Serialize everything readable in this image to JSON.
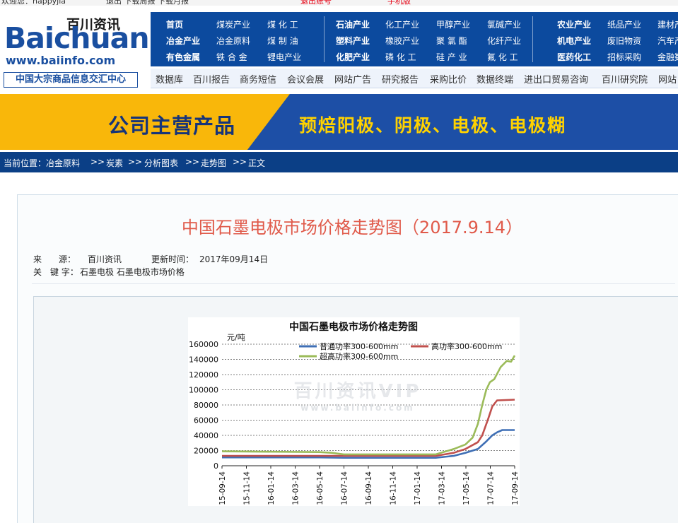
{
  "top_strip": [
    "欢迎您：happyjia",
    "退出  下载周报  下载月报",
    "退出账号",
    "手机版"
  ],
  "logo": {
    "wordmark_main": "Baichuan",
    "wordmark_cn": "百川资讯",
    "url": "www.baiinfo.com",
    "slogan": "中国大宗商品信息交汇中心"
  },
  "nav_grid": [
    [
      "首页",
      "煤炭产业",
      "煤 化 工",
      "石油产业",
      "化工产业",
      "甲醇产业",
      "氯碱产业",
      "农业产业",
      "纸品产业",
      "建材产"
    ],
    [
      "冶金产业",
      "冶金原料",
      "煤 制 油",
      "塑料产业",
      "橡胶产业",
      "聚 氯 酯",
      "化纤产业",
      "机电产业",
      "废旧物资",
      "汽车产"
    ],
    [
      "有色金属",
      "铁 合 金",
      "锂电产业",
      "化肥产业",
      "磷 化 工",
      "硅 产 业",
      "氟 化 工",
      "医药化工",
      "招标采购",
      "金融数"
    ]
  ],
  "sub_nav": [
    "数据库",
    "百川报告",
    "商务短信",
    "会议会展",
    "网站广告",
    "研究报告",
    "采购比价",
    "数据终端",
    "进出口贸易咨询",
    "百川研究院",
    "网站"
  ],
  "banner": {
    "title": "公司主营产品",
    "products": "预焙阳极、阴极、电极、电极糊",
    "colors": {
      "left": "#f9b70a",
      "right": "#1d4fa6"
    }
  },
  "breadcrumb": [
    "当前位置：冶金原料",
    ">>",
    "炭素",
    ">>",
    "分析图表",
    ">>",
    "走势图",
    ">>",
    "正文"
  ],
  "article": {
    "title": "中国石墨电极市场价格走势图（2017.9.14）",
    "source_label": "来　　源：",
    "source": "百川资讯",
    "updated_label": "更新时间：",
    "updated": "2017年09月14日",
    "keywords_label": "关　键 字：",
    "keywords": "石墨电极 石墨电极市场价格"
  },
  "chart_data": {
    "type": "line",
    "title": "中国石墨电极市场价格走势图",
    "ylabel": "元/吨",
    "xlabel": "",
    "ylim": [
      0,
      160000
    ],
    "yticks": [
      0,
      20000,
      40000,
      60000,
      80000,
      100000,
      120000,
      140000,
      160000
    ],
    "xticks": [
      "15-09-14",
      "15-11-14",
      "16-01-14",
      "16-03-14",
      "16-05-14",
      "16-07-14",
      "16-09-14",
      "16-11-14",
      "17-01-14",
      "17-03-14",
      "17-05-14",
      "17-07-14",
      "17-09-14"
    ],
    "grid": true,
    "legend_placement": "top",
    "watermark": [
      "百川资讯VIP",
      "www.baiinfo.com"
    ],
    "series": [
      {
        "name": "普通功率300-600mm",
        "color": "#3f6fb5",
        "points": [
          [
            "2015-09-14",
            11000
          ],
          [
            "2016-05-14",
            11000
          ],
          [
            "2016-07-14",
            10500
          ],
          [
            "2017-03-01",
            10500
          ],
          [
            "2017-04-15",
            13000
          ],
          [
            "2017-05-14",
            17000
          ],
          [
            "2017-06-14",
            22000
          ],
          [
            "2017-07-05",
            32000
          ],
          [
            "2017-07-20",
            40000
          ],
          [
            "2017-08-01",
            44000
          ],
          [
            "2017-08-14",
            47000
          ],
          [
            "2017-09-14",
            47000
          ]
        ]
      },
      {
        "name": "高功率300-600mm",
        "color": "#c0504d",
        "points": [
          [
            "2015-09-14",
            13000
          ],
          [
            "2016-05-14",
            13000
          ],
          [
            "2016-07-14",
            13000
          ],
          [
            "2017-03-01",
            13000
          ],
          [
            "2017-04-15",
            17000
          ],
          [
            "2017-05-14",
            22000
          ],
          [
            "2017-06-14",
            31000
          ],
          [
            "2017-06-25",
            40000
          ],
          [
            "2017-07-10",
            62000
          ],
          [
            "2017-07-20",
            78000
          ],
          [
            "2017-08-01",
            86000
          ],
          [
            "2017-09-14",
            87000
          ]
        ]
      },
      {
        "name": "超高功率300-600mm",
        "color": "#9bbb59",
        "points": [
          [
            "2015-09-14",
            19000
          ],
          [
            "2016-05-14",
            18000
          ],
          [
            "2016-06-14",
            17000
          ],
          [
            "2016-07-14",
            15000
          ],
          [
            "2017-03-01",
            15000
          ],
          [
            "2017-04-15",
            22000
          ],
          [
            "2017-05-14",
            28000
          ],
          [
            "2017-06-01",
            37000
          ],
          [
            "2017-06-14",
            55000
          ],
          [
            "2017-06-25",
            80000
          ],
          [
            "2017-07-05",
            100000
          ],
          [
            "2017-07-14",
            110000
          ],
          [
            "2017-07-25",
            114000
          ],
          [
            "2017-08-10",
            130000
          ],
          [
            "2017-08-25",
            138000
          ],
          [
            "2017-09-05",
            137000
          ],
          [
            "2017-09-14",
            145000
          ]
        ]
      }
    ]
  }
}
